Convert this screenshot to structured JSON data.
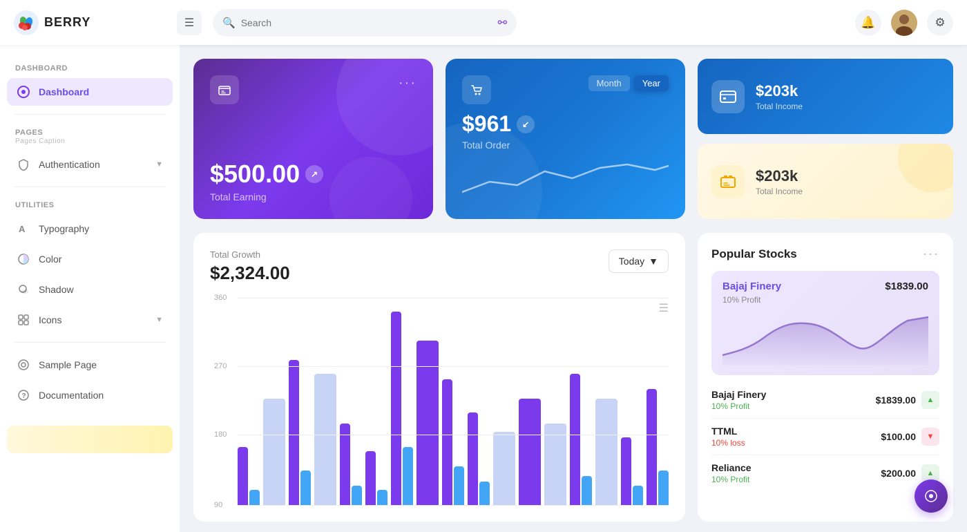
{
  "app": {
    "name": "BERRY"
  },
  "header": {
    "search_placeholder": "Search",
    "hamburger_label": "☰",
    "notification_icon": "🔔",
    "settings_icon": "⚙"
  },
  "sidebar": {
    "dashboard_section": "Dashboard",
    "dashboard_item": "Dashboard",
    "pages_section": "Pages",
    "pages_caption": "Pages Caption",
    "authentication_item": "Authentication",
    "utilities_section": "Utilities",
    "typography_item": "Typography",
    "color_item": "Color",
    "shadow_item": "Shadow",
    "icons_item": "Icons",
    "sample_page_item": "Sample Page",
    "documentation_item": "Documentation"
  },
  "cards": {
    "earning": {
      "amount": "$500.00",
      "label": "Total Earning"
    },
    "order": {
      "amount": "$961",
      "label": "Total Order",
      "toggle_month": "Month",
      "toggle_year": "Year"
    },
    "total_income_blue": {
      "amount": "$203k",
      "label": "Total Income"
    },
    "total_income_yellow": {
      "amount": "$203k",
      "label": "Total Income"
    }
  },
  "chart": {
    "title": "Total Growth",
    "amount": "$2,324.00",
    "today_btn": "Today",
    "grid_labels": [
      "360",
      "270",
      "180",
      "90"
    ],
    "menu_icon": "≡",
    "bars": [
      {
        "purple": 30,
        "blue": 8,
        "light": 0
      },
      {
        "purple": 0,
        "blue": 0,
        "light": 55
      },
      {
        "purple": 75,
        "blue": 18,
        "light": 0
      },
      {
        "purple": 0,
        "blue": 0,
        "light": 68
      },
      {
        "purple": 42,
        "blue": 10,
        "light": 0
      },
      {
        "purple": 28,
        "blue": 8,
        "light": 0
      },
      {
        "purple": 100,
        "blue": 30,
        "light": 0
      },
      {
        "purple": 85,
        "blue": 0,
        "light": 0
      },
      {
        "purple": 65,
        "blue": 20,
        "light": 0
      },
      {
        "purple": 48,
        "blue": 12,
        "light": 0
      },
      {
        "purple": 0,
        "blue": 0,
        "light": 38
      },
      {
        "purple": 55,
        "blue": 0,
        "light": 0
      },
      {
        "purple": 0,
        "blue": 0,
        "light": 42
      },
      {
        "purple": 68,
        "blue": 15,
        "light": 0
      },
      {
        "purple": 0,
        "blue": 0,
        "light": 55
      },
      {
        "purple": 35,
        "blue": 10,
        "light": 0
      },
      {
        "purple": 60,
        "blue": 18,
        "light": 0
      }
    ]
  },
  "stocks": {
    "title": "Popular Stocks",
    "highlight": {
      "name": "Bajaj Finery",
      "price": "$1839.00",
      "profit_label": "10% Profit"
    },
    "rows": [
      {
        "name": "Bajaj Finery",
        "price": "$1839.00",
        "label": "10% Profit",
        "trend": "up",
        "label_class": "profit-green"
      },
      {
        "name": "TTML",
        "price": "$100.00",
        "label": "10% loss",
        "trend": "down",
        "label_class": "loss-red"
      },
      {
        "name": "Reliance",
        "price": "$200.00",
        "label": "10% Profit",
        "trend": "up",
        "label_class": "profit-green"
      }
    ]
  }
}
